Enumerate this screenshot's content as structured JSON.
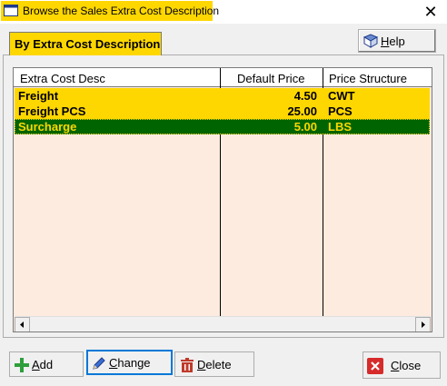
{
  "window": {
    "title": "Browse the Sales Extra Cost Description",
    "close_glyph": "✕"
  },
  "tab": {
    "label": "By Extra Cost Description"
  },
  "help_button": {
    "label_underline": "H",
    "label_rest": "elp",
    "icon": "help-book-icon"
  },
  "table": {
    "columns": [
      "Extra Cost Desc",
      "Default Price",
      "Price Structure"
    ],
    "rows": [
      {
        "desc": "Freight",
        "price": "4.50",
        "structure": "CWT",
        "selected": false
      },
      {
        "desc": "Freight PCS",
        "price": "25.00",
        "structure": "PCS",
        "selected": false
      },
      {
        "desc": "Surcharge",
        "price": "5.00",
        "structure": "LBS",
        "selected": true
      }
    ]
  },
  "buttons": {
    "add": {
      "u": "A",
      "rest": "dd",
      "icon": "plus-icon"
    },
    "change": {
      "u": "C",
      "rest": "hange",
      "icon": "pencil-icon"
    },
    "delete": {
      "u": "D",
      "rest": "elete",
      "icon": "trash-icon"
    },
    "close": {
      "u": "C",
      "rest": "lose",
      "icon": "close-icon"
    }
  },
  "colors": {
    "highlight_yellow": "#ffd700",
    "selected_green": "#006400",
    "grid_background": "#fdebdf"
  }
}
